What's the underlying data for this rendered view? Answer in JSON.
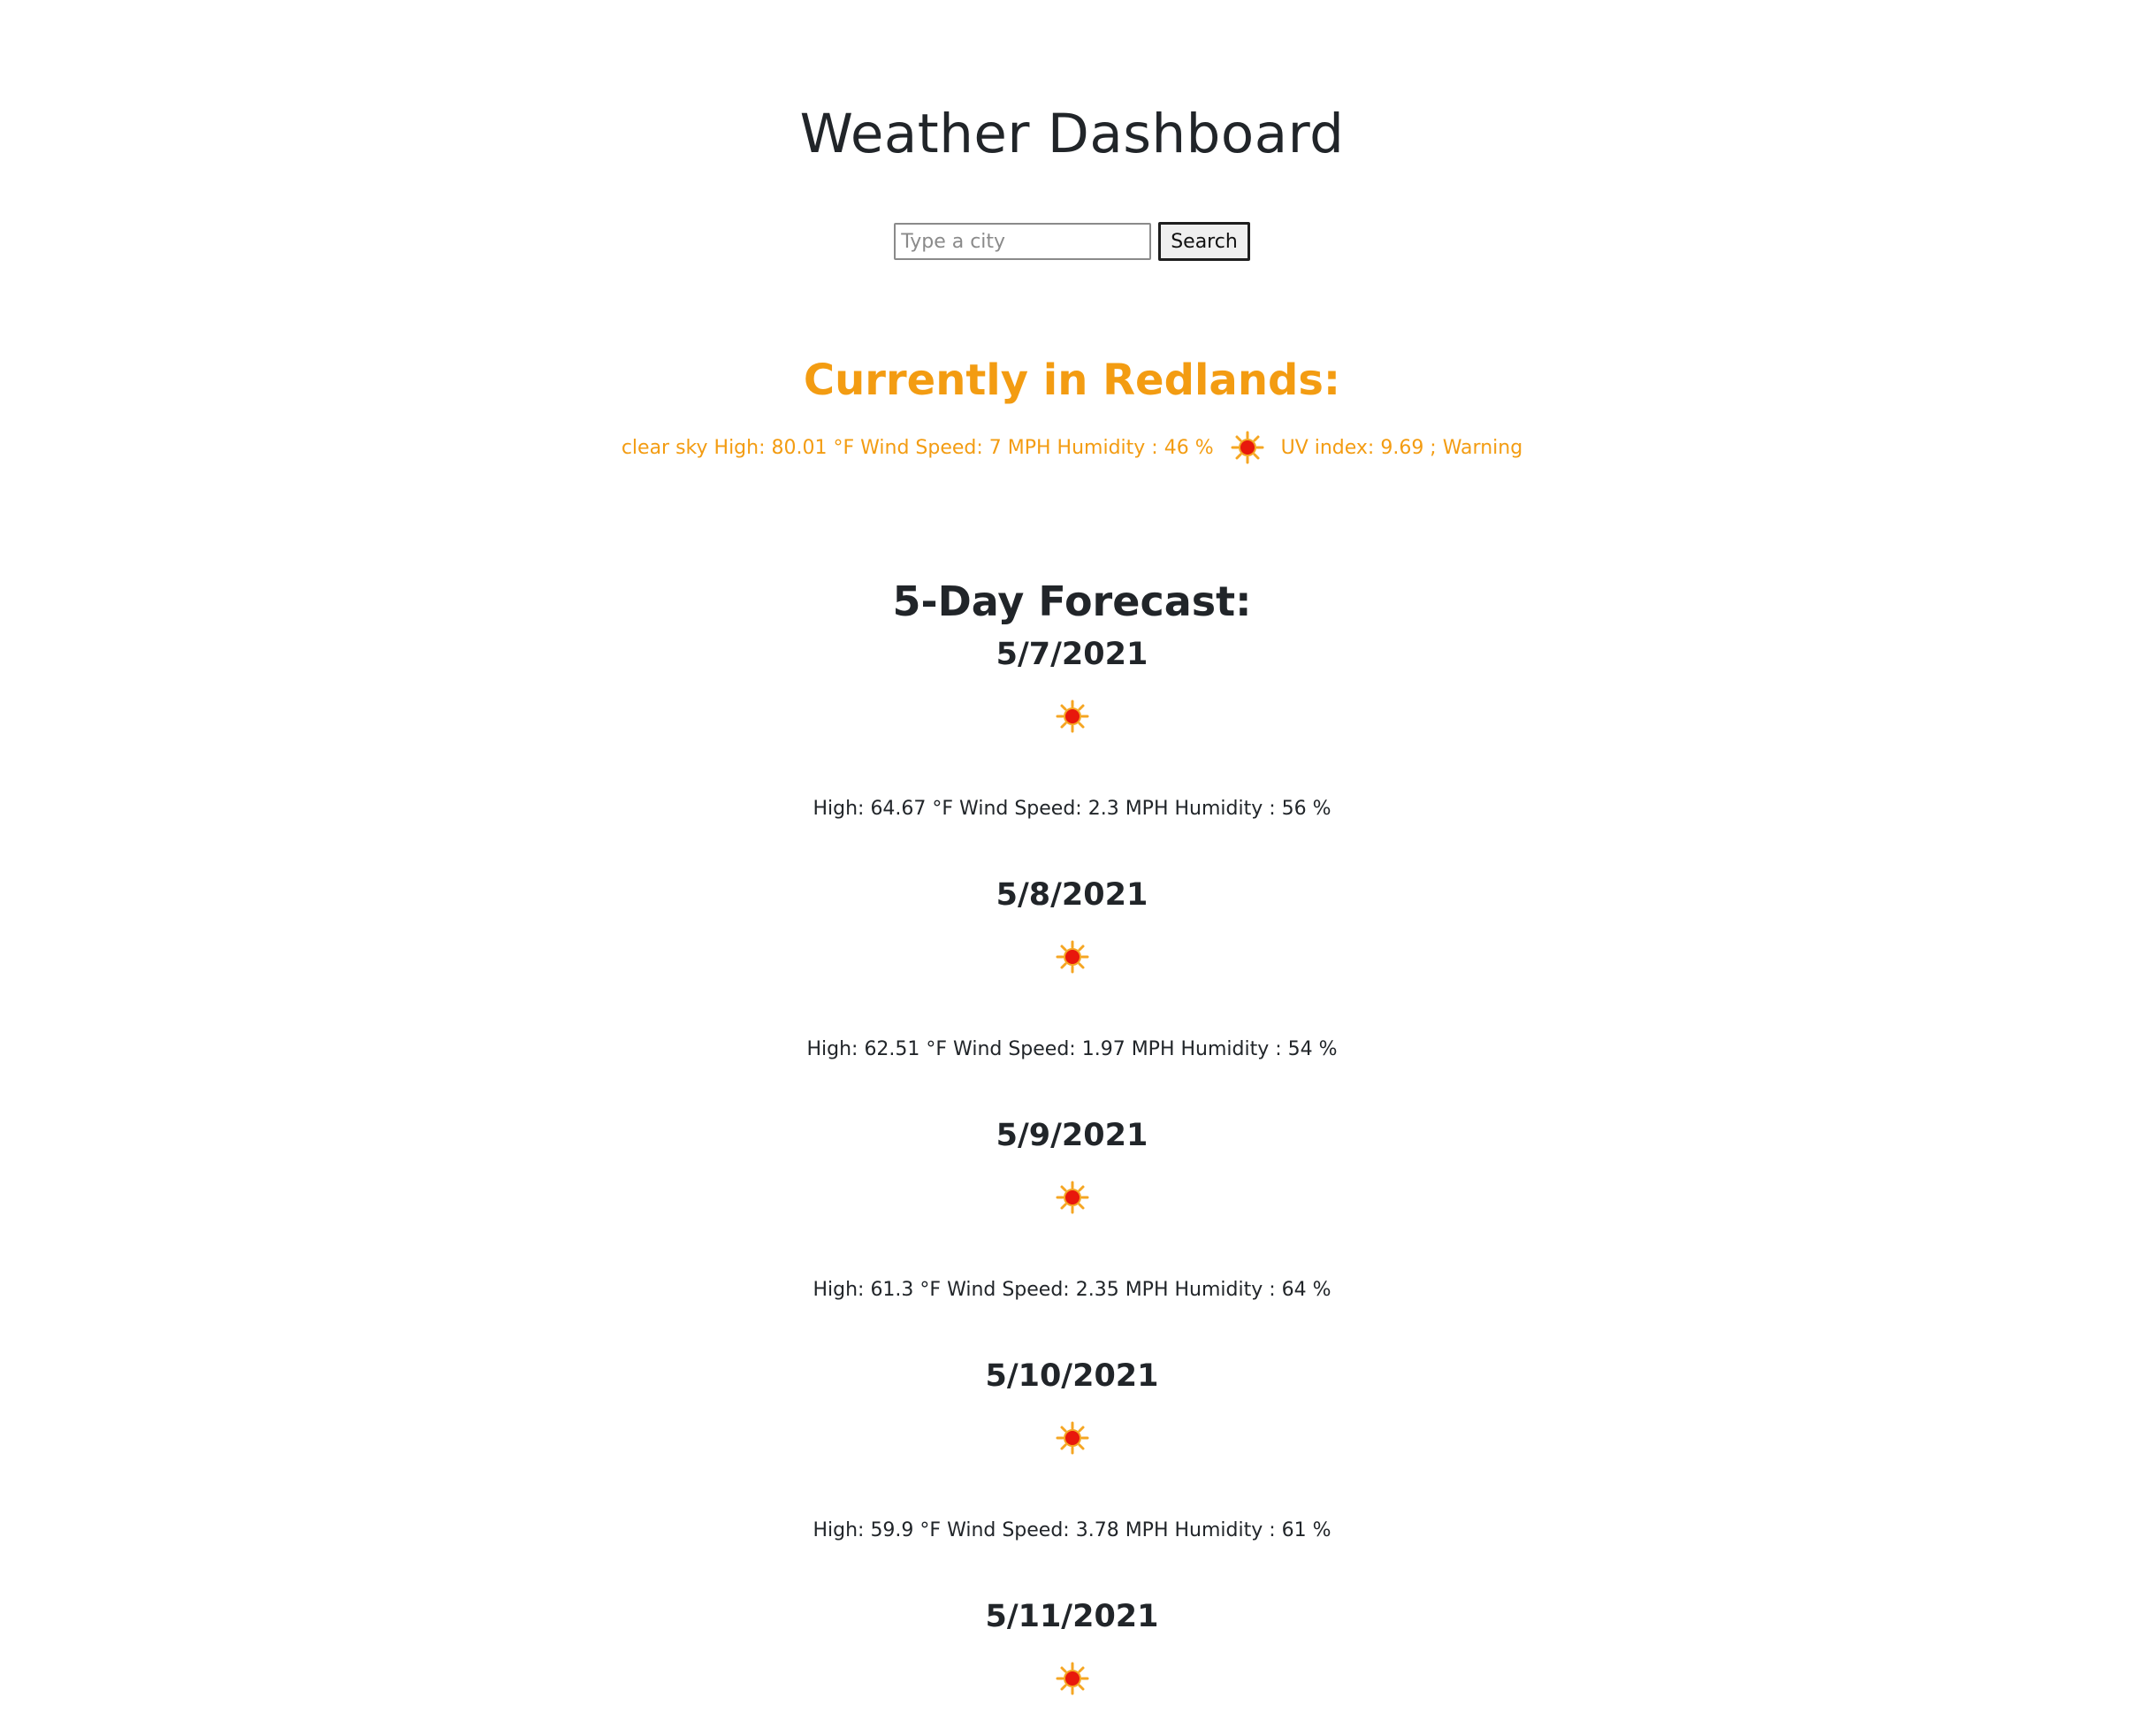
{
  "page": {
    "title": "Weather Dashboard"
  },
  "search": {
    "placeholder": "Type a city",
    "value": "",
    "button_label": "Search"
  },
  "current": {
    "heading": "Currently in Redlands:",
    "description": "clear sky",
    "stats": "High: 80.01 °F Wind Speed: 7 MPH Humidity : 46 %",
    "icon": "sun-icon",
    "uv_text": "UV index: 9.69 ; Warning",
    "color": "#f39c12"
  },
  "forecast": {
    "heading": "5-Day Forecast:",
    "days": [
      {
        "date": "5/7/2021",
        "icon": "sun-icon",
        "stats": "High: 64.67 °F Wind Speed: 2.3 MPH Humidity : 56 %"
      },
      {
        "date": "5/8/2021",
        "icon": "sun-icon",
        "stats": "High: 62.51 °F Wind Speed: 1.97 MPH Humidity : 54 %"
      },
      {
        "date": "5/9/2021",
        "icon": "sun-icon",
        "stats": "High: 61.3 °F Wind Speed: 2.35 MPH Humidity : 64 %"
      },
      {
        "date": "5/10/2021",
        "icon": "sun-icon",
        "stats": "High: 59.9 °F Wind Speed: 3.78 MPH Humidity : 61 %"
      },
      {
        "date": "5/11/2021",
        "icon": "sun-icon",
        "stats": ""
      }
    ]
  }
}
